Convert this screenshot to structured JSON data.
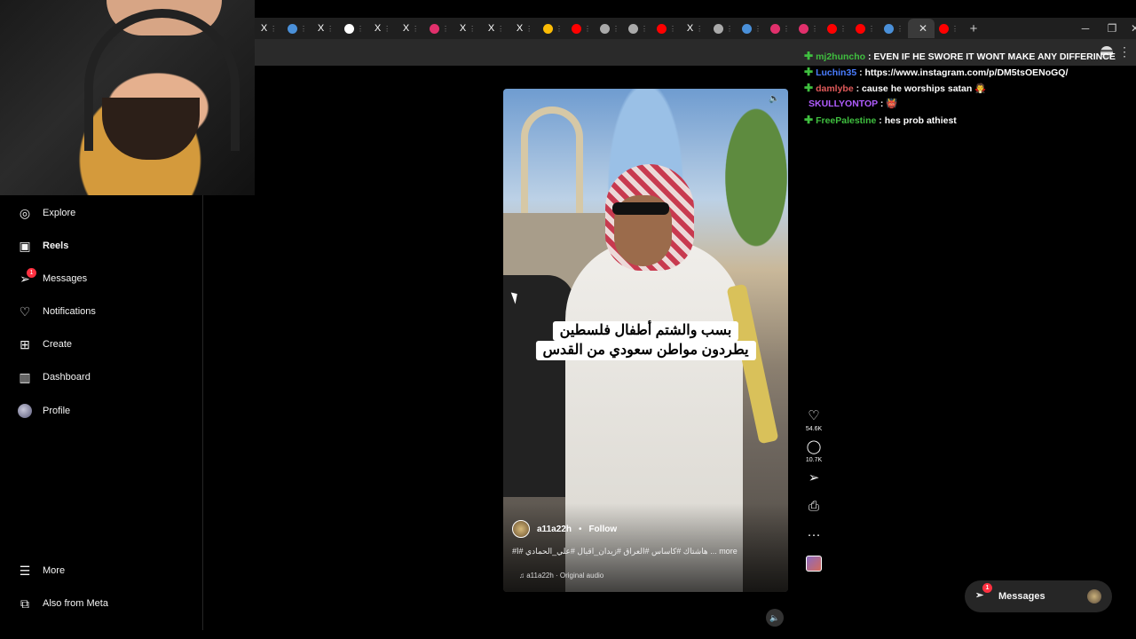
{
  "browser": {
    "tabs": [
      {
        "icon": "x-icon",
        "color": "#ffffff",
        "glyph": "X"
      },
      {
        "icon": "web-icon",
        "color": "#4a90d9",
        "glyph": ""
      },
      {
        "icon": "x-icon",
        "color": "#ffffff",
        "glyph": "X"
      },
      {
        "icon": "shield-icon",
        "color": "#ffffff",
        "glyph": ""
      },
      {
        "icon": "x-icon",
        "color": "#ffffff",
        "glyph": "X"
      },
      {
        "icon": "x-icon",
        "color": "#ffffff",
        "glyph": "X"
      },
      {
        "icon": "instagram-icon",
        "color": "#e1306c",
        "glyph": ""
      },
      {
        "icon": "x-icon",
        "color": "#ffffff",
        "glyph": "X"
      },
      {
        "icon": "x-icon",
        "color": "#ffffff",
        "glyph": "X"
      },
      {
        "icon": "x-icon",
        "color": "#ffffff",
        "glyph": "X"
      },
      {
        "icon": "google-icon",
        "color": "#fbbc05",
        "glyph": ""
      },
      {
        "icon": "youtube-icon",
        "color": "#ff0000",
        "glyph": ""
      },
      {
        "icon": "globe-icon",
        "color": "#aaaaaa",
        "glyph": ""
      },
      {
        "icon": "globe-icon",
        "color": "#aaaaaa",
        "glyph": ""
      },
      {
        "icon": "youtube-icon",
        "color": "#ff0000",
        "glyph": ""
      },
      {
        "icon": "x-icon",
        "color": "#ffffff",
        "glyph": "X"
      },
      {
        "icon": "gear-icon",
        "color": "#aaaaaa",
        "glyph": ""
      },
      {
        "icon": "web-icon",
        "color": "#4a90d9",
        "glyph": ""
      },
      {
        "icon": "instagram-icon",
        "color": "#e1306c",
        "glyph": ""
      },
      {
        "icon": "instagram-icon",
        "color": "#e1306c",
        "glyph": ""
      },
      {
        "icon": "youtube-icon",
        "color": "#ff0000",
        "glyph": ""
      },
      {
        "icon": "youtube-icon",
        "color": "#ff0000",
        "glyph": ""
      },
      {
        "icon": "web-icon",
        "color": "#4a90d9",
        "glyph": ""
      },
      {
        "icon": "youtube-icon",
        "color": "#ff0000",
        "glyph": ""
      }
    ],
    "active_close": "✕",
    "new_tab": "+",
    "minimize": "─",
    "restore": "❐",
    "close": "✕"
  },
  "sidebar": {
    "items": [
      {
        "label": "Explore",
        "icon": "compass-icon",
        "glyph": "◎",
        "bold": false
      },
      {
        "label": "Reels",
        "icon": "reels-icon",
        "glyph": "▣",
        "bold": true
      },
      {
        "label": "Messages",
        "icon": "messenger-icon",
        "glyph": "➢",
        "bold": false,
        "badge": "1"
      },
      {
        "label": "Notifications",
        "icon": "heart-icon",
        "glyph": "♡",
        "bold": false
      },
      {
        "label": "Create",
        "icon": "plus-square-icon",
        "glyph": "⊞",
        "bold": false
      },
      {
        "label": "Dashboard",
        "icon": "chart-icon",
        "glyph": "▥",
        "bold": false
      },
      {
        "label": "Profile",
        "icon": "avatar-icon",
        "glyph": "",
        "bold": false
      }
    ],
    "more": {
      "label": "More",
      "glyph": "☰"
    },
    "meta": {
      "label": "Also from Meta",
      "glyph": "⧉"
    }
  },
  "reel": {
    "caption_line1": "بسب والشتم أطفال فلسطين",
    "caption_line2": "يطردون مواطن سعودي من القدس",
    "username": "a11a22h",
    "follow_label": "Follow",
    "dot": "•",
    "description": "#هاشتاك #كاساس #العراق #زيدان_اقبال #علي_الحمادي #ا ... more",
    "audio": "a11a22h · Original audio",
    "likes": "54.6K",
    "comments": "10.7K"
  },
  "chat": [
    {
      "user": "mj2huncho",
      "user_color": "#3fbf3f",
      "plus": true,
      "message": " : EVEN IF HE SWORE IT WONT MAKE ANY DIFFERINCE"
    },
    {
      "user": "Luchin35",
      "user_color": "#4a7dff",
      "plus": true,
      "message": " : https://www.instagram.com/p/DM5tsOENoGQ/"
    },
    {
      "user": "damlybe",
      "user_color": "#e05a5a",
      "plus": true,
      "message": " : cause he worships satan 🧛"
    },
    {
      "user": "SKULLYONTOP",
      "user_color": "#b05cff",
      "plus": false,
      "message": " : 👹"
    },
    {
      "user": "FreePalestine",
      "user_color": "#3fbf3f",
      "plus": true,
      "message": " : hes prob athiest"
    }
  ],
  "messages_pill": {
    "label": "Messages",
    "badge": "1"
  }
}
